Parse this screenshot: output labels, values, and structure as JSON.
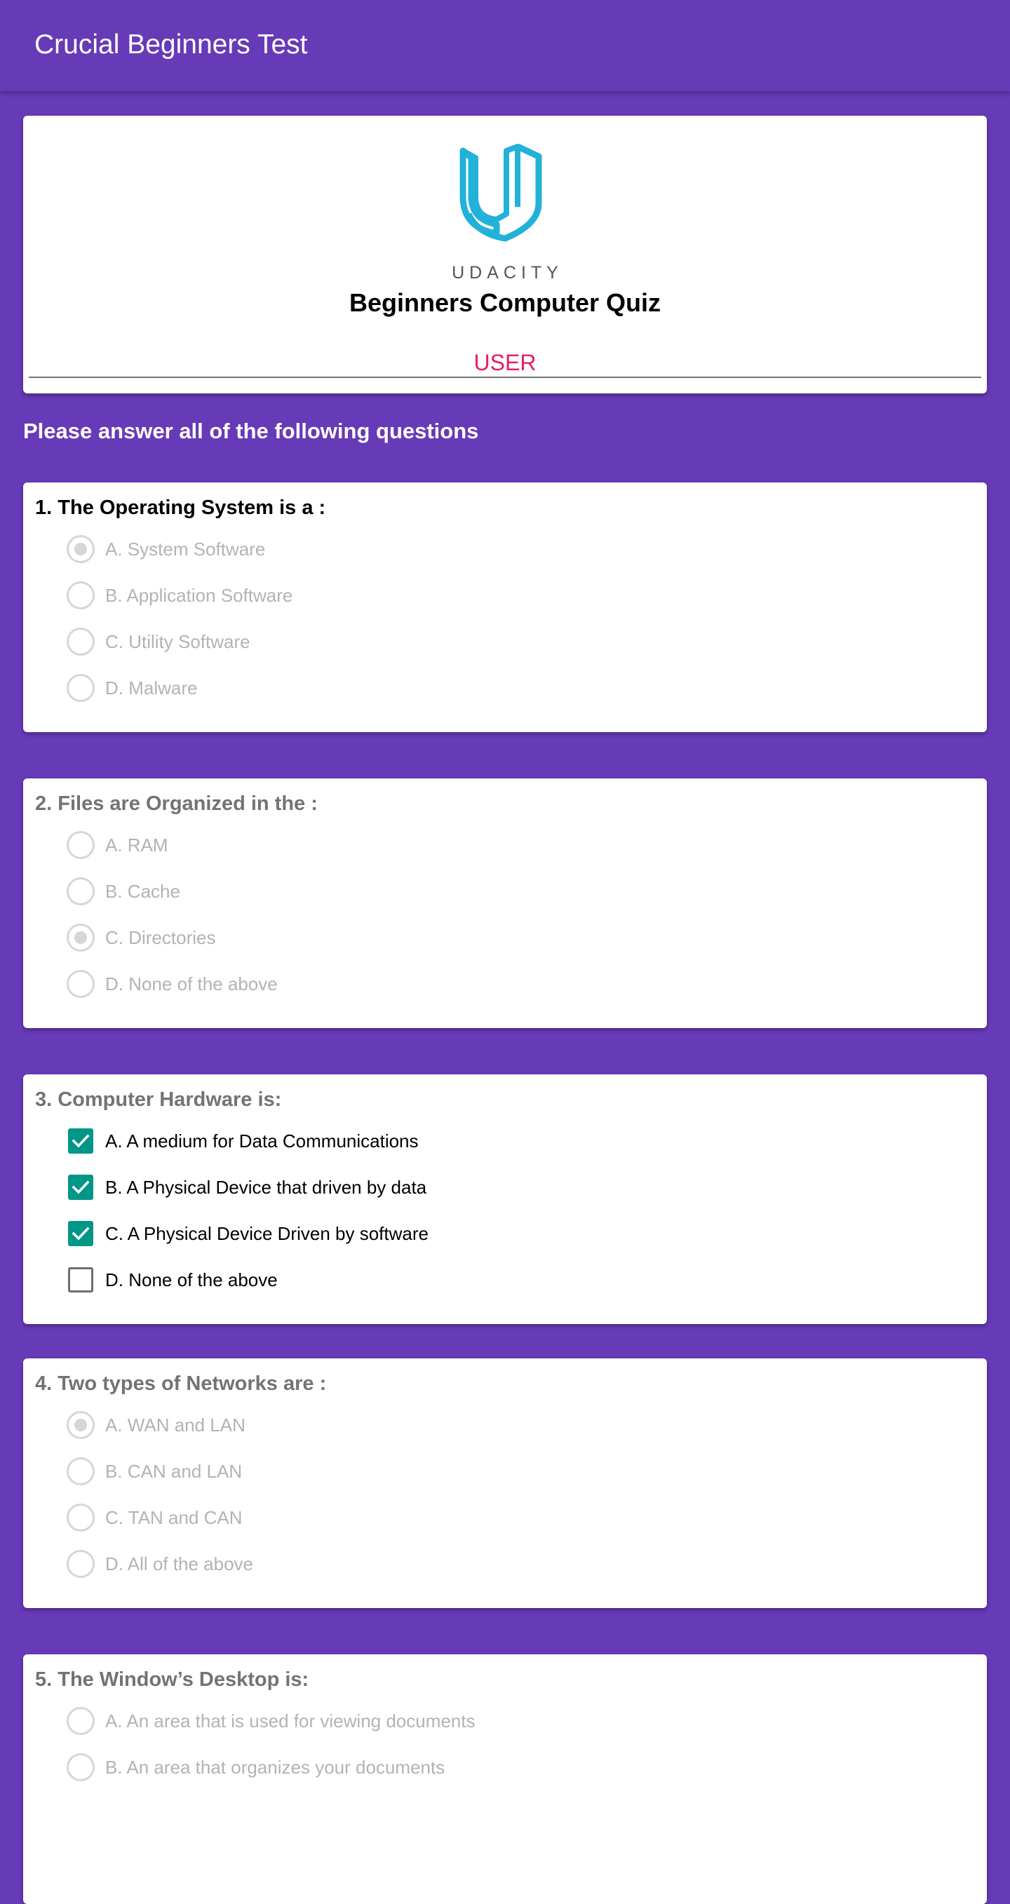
{
  "app_bar": {
    "title": "Crucial Beginners Test"
  },
  "header": {
    "brand": "UDACITY",
    "quiz_title": "Beginners Computer Quiz",
    "user_label": "USER"
  },
  "instructions": "Please answer all of the following questions",
  "colors": {
    "primary": "#673ab7",
    "accent": "#e91e63",
    "checkbox": "#009688",
    "logo": "#22b1d9"
  },
  "questions": [
    {
      "title": "1. The Operating System is a :",
      "type": "radio",
      "options": [
        {
          "label": "A. System Software",
          "selected": true
        },
        {
          "label": "B. Application Software",
          "selected": false
        },
        {
          "label": "C. Utility Software",
          "selected": false
        },
        {
          "label": "D. Malware",
          "selected": false
        }
      ]
    },
    {
      "title": "2. Files are Organized in the :",
      "type": "radio",
      "options": [
        {
          "label": "A. RAM",
          "selected": false
        },
        {
          "label": "B. Cache",
          "selected": false
        },
        {
          "label": "C. Directories",
          "selected": true
        },
        {
          "label": "D. None of the above",
          "selected": false
        }
      ]
    },
    {
      "title": "3. Computer Hardware is:",
      "type": "checkbox",
      "options": [
        {
          "label": "A. A medium for Data Communications",
          "selected": true
        },
        {
          "label": "B. A Physical Device that driven by data",
          "selected": true
        },
        {
          "label": "C. A Physical Device Driven by software",
          "selected": true
        },
        {
          "label": "D. None of the above",
          "selected": false
        }
      ]
    },
    {
      "title": "4. Two types of Networks are :",
      "type": "radio",
      "options": [
        {
          "label": "A. WAN and LAN",
          "selected": true
        },
        {
          "label": "B. CAN and LAN",
          "selected": false
        },
        {
          "label": "C. TAN and CAN",
          "selected": false
        },
        {
          "label": "D. All of the above",
          "selected": false
        }
      ]
    },
    {
      "title": "5. The Window’s Desktop is:",
      "type": "radio",
      "options": [
        {
          "label": "A. An area that is used for viewing documents",
          "selected": false
        },
        {
          "label": "B. An area that organizes your documents",
          "selected": false
        }
      ]
    }
  ]
}
